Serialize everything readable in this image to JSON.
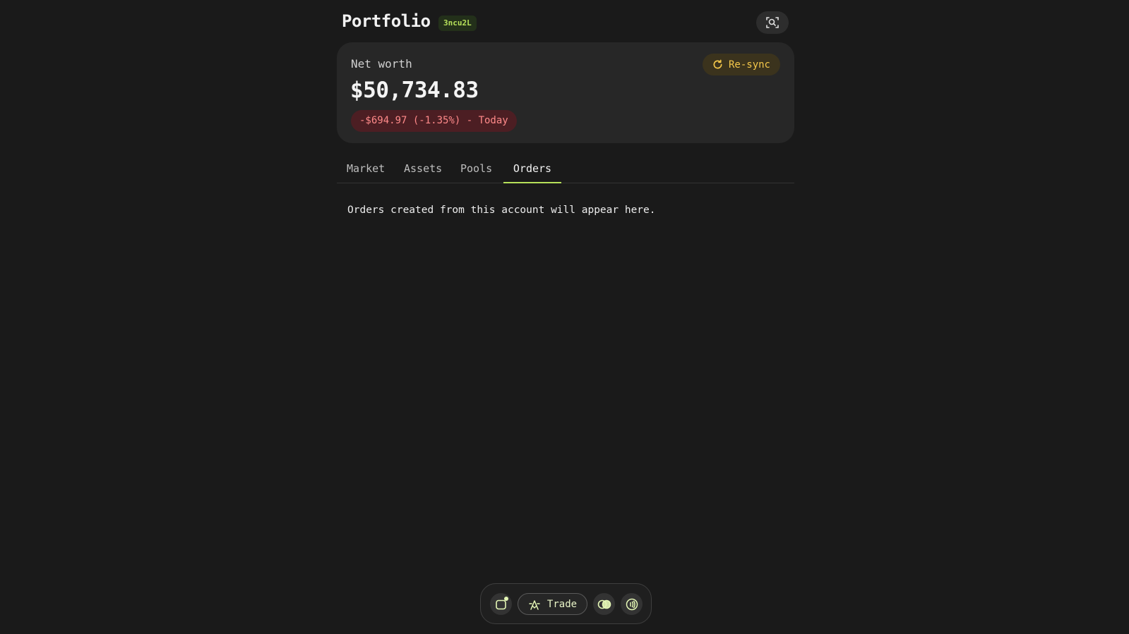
{
  "header": {
    "title": "Portfolio",
    "account_badge": "3ncu2L",
    "scan_icon": "scan-icon"
  },
  "networth": {
    "label": "Net worth",
    "value": "$50,734.83",
    "change": "-$694.97 (-1.35%) - Today",
    "resync_label": "Re-sync",
    "resync_icon": "refresh-icon"
  },
  "tabs": [
    {
      "label": "Market",
      "active": false
    },
    {
      "label": "Assets",
      "active": false
    },
    {
      "label": "Pools",
      "active": false
    },
    {
      "label": "Orders",
      "active": true
    }
  ],
  "orders": {
    "empty_message": "Orders created from this account will appear here."
  },
  "dock": {
    "trade_label": "Trade",
    "icons": [
      "wallet-notification-icon",
      "trade-icon",
      "swap-circles-icon",
      "nfc-icon"
    ]
  },
  "colors": {
    "background": "#1a1a1a",
    "card": "#272727",
    "accent": "#b6e15a",
    "negative": "#ff8a8a",
    "resync": "#f5c84a"
  }
}
